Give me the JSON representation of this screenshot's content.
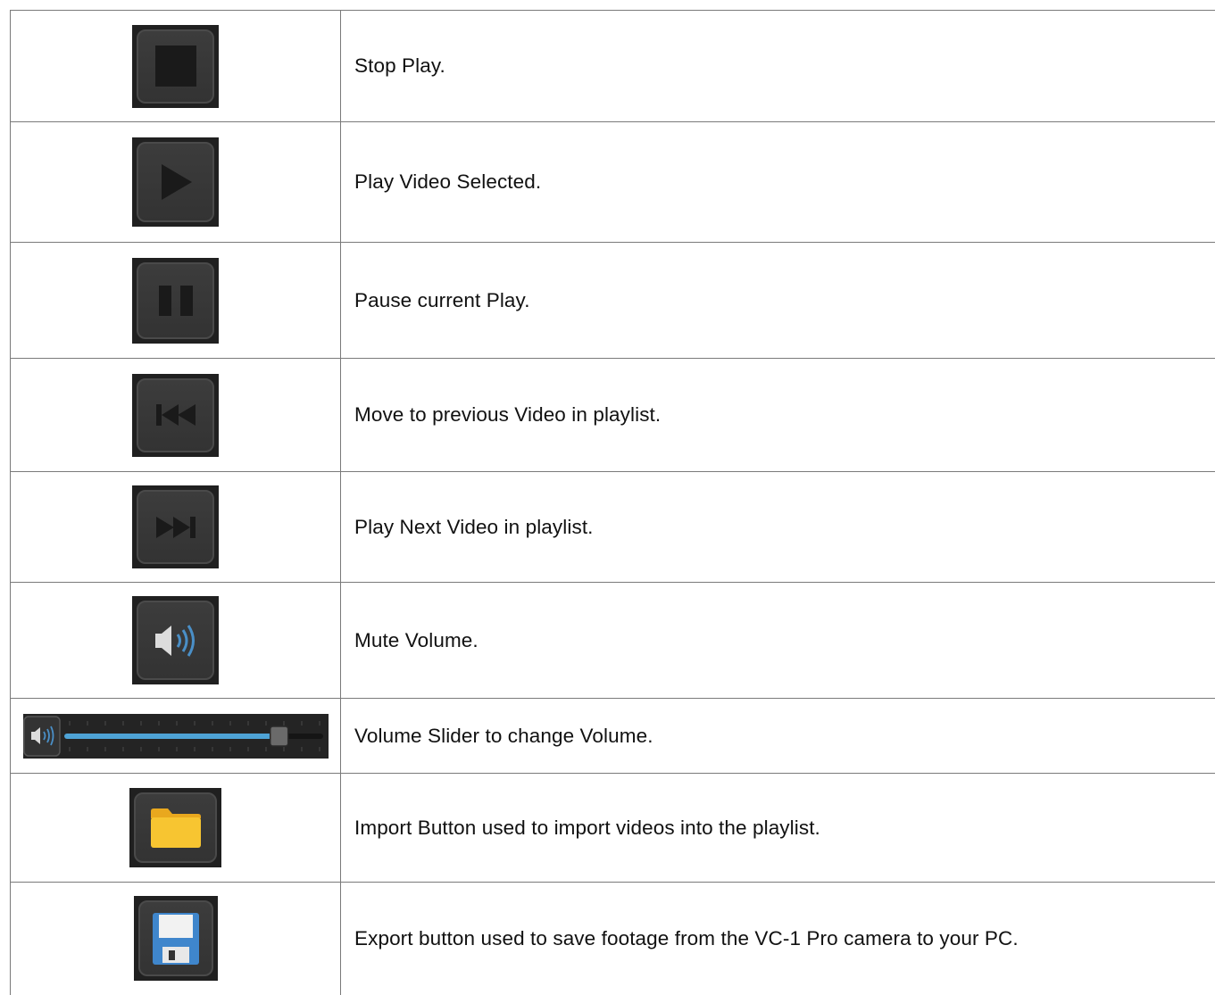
{
  "controls": [
    {
      "icon": "stop-icon",
      "description": "Stop Play."
    },
    {
      "icon": "play-icon",
      "description": "Play Video Selected."
    },
    {
      "icon": "pause-icon",
      "description": "Pause current Play."
    },
    {
      "icon": "previous-track-icon",
      "description": "Move to previous Video in playlist."
    },
    {
      "icon": "next-track-icon",
      "description": "Play Next Video in playlist."
    },
    {
      "icon": "speaker-icon",
      "description": "Mute Volume."
    },
    {
      "icon": "volume-slider",
      "description": "Volume Slider to change Volume.",
      "level": 0.83
    },
    {
      "icon": "folder-icon",
      "description": "Import Button used to import videos into the playlist."
    },
    {
      "icon": "floppy-disk-icon",
      "description": "Export button used to save footage from the VC-1 Pro camera to your PC."
    }
  ],
  "colors": {
    "button_bg": "#202020",
    "button_face": "#3a3a3a",
    "icon_dark": "#1a1a1a",
    "speaker_wave": "#4a8fc7",
    "slider_fill": "#4ea3d6",
    "folder": "#f7c531",
    "floppy": "#3f86cc"
  }
}
